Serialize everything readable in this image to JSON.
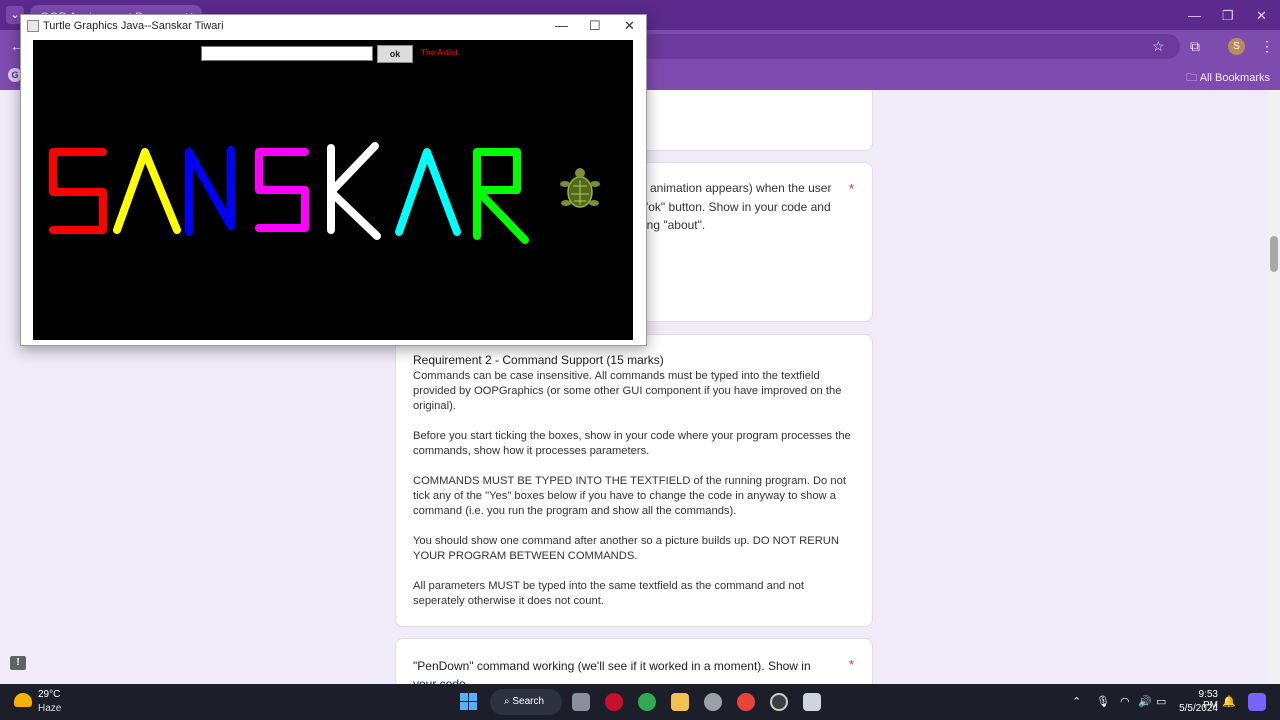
{
  "browser": {
    "tab_title": "OOP Assignment Demo",
    "bookmarks_label": "All Bookmarks",
    "profile_initial": "S"
  },
  "java_window": {
    "title": "Turtle Graphics Java--Sanskar Tiwari",
    "command_value": "",
    "ok_label": "ok",
    "artist_label": "The Artist",
    "drawn_text": "SANSKAR",
    "letter_colors": [
      "#ff0000",
      "#ffff00",
      "#0000ff",
      "#ff00ff",
      "#ffffff",
      "#00ffff",
      "#00ff00"
    ]
  },
  "form": {
    "question1_partial": [
      "animation appears) when the user",
      "\"ok\" button. Show in your code and",
      "ing \"about\"."
    ],
    "req2_title": "Requirement 2 - Command Support (15 marks)",
    "req2_paragraphs": [
      "Commands can be case insensitive. All commands must be typed into the textfield provided by OOPGraphics (or some other GUI component if you have improved on the original).",
      "Before you start ticking the boxes, show in your code where your program processes the commands, show how it processes parameters.",
      "COMMANDS MUST BE TYPED INTO THE TEXTFIELD of the running program. Do not tick any of the \"Yes\" boxes below if you have to change the code in anyway to show a command (i.e. you run the program and show all the commands).",
      "You should show one command after another so a picture builds up. DO NOT RERUN YOUR PROGRAM BETWEEN COMMANDS.",
      "All parameters MUST be typed into the same textfield as the command and not seperately otherwise it does not count."
    ],
    "question3_text": "\"PenDown\" command working (we'll see if it worked in a moment). Show in your code",
    "required_mark": "*"
  },
  "taskbar": {
    "temperature": "29°C",
    "condition": "Haze",
    "search_label": "Search",
    "time": "9:53 PM",
    "date": "5/5/2024"
  },
  "icons": [
    "chevron-down-icon",
    "close-icon",
    "minimize-icon",
    "maximize-icon",
    "star-icon",
    "extensions-icon",
    "menu-dots-icon",
    "folder-icon",
    "feedback-icon",
    "turtle-icon",
    "windows-start-icon",
    "search-icon",
    "wifi-icon",
    "volume-icon",
    "battery-icon",
    "bell-icon"
  ]
}
